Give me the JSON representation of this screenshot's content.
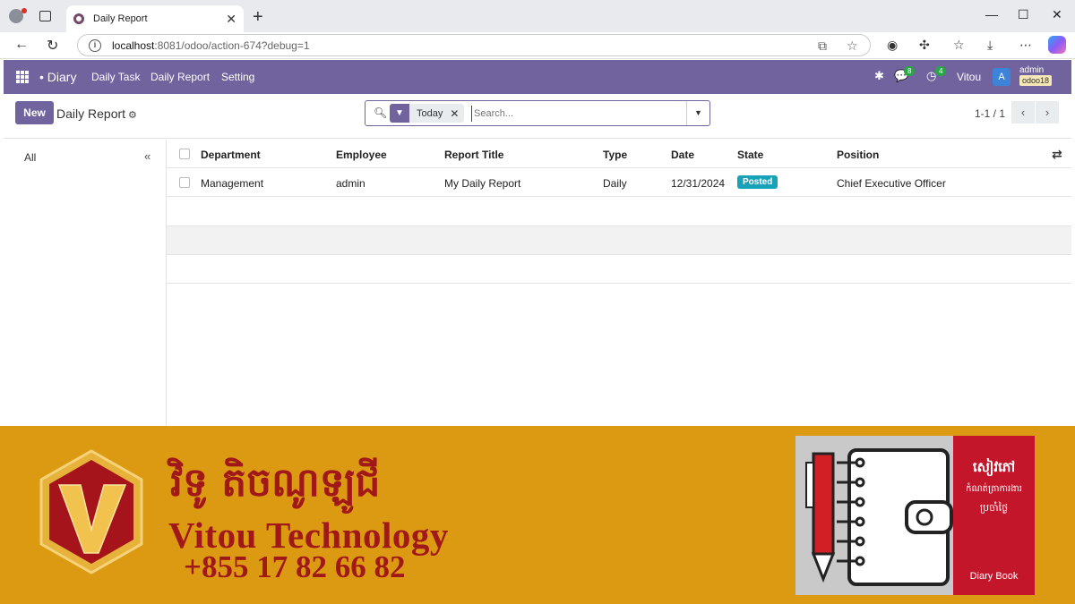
{
  "browser": {
    "tab_title": "Daily Report",
    "url_host": "localhost",
    "url_path": ":8081/odoo/action-674?debug=1"
  },
  "navbar": {
    "brand": "• Diary",
    "menu": [
      "Daily Task",
      "Daily Report",
      "Setting"
    ],
    "messages_count": "8",
    "activities_count": "4",
    "company_name": "Vitou",
    "avatar_letter": "A",
    "user_name": "admin",
    "db_name": "odoo18"
  },
  "control_panel": {
    "new_label": "New",
    "breadcrumb": "Daily Report",
    "facet_label": "Today",
    "search_placeholder": "Search...",
    "pager": "1-1 / 1"
  },
  "side_panel": {
    "all_label": "All",
    "collapse_symbol": "«"
  },
  "list": {
    "columns": [
      "Department",
      "Employee",
      "Report Title",
      "Type",
      "Date",
      "State",
      "Position"
    ],
    "rows": [
      {
        "department": "Management",
        "employee": "admin",
        "report_title": "My Daily Report",
        "type": "Daily",
        "date": "12/31/2024",
        "state": "Posted",
        "position": "Chief Executive Officer"
      }
    ]
  },
  "banner": {
    "khmer_title": "វិទូ តិចណូឡូជី",
    "company": "Vitou Technology",
    "phone": "+855 17 82 66 82",
    "book_khmer_1": "សៀវភៅ",
    "book_khmer_2": "កំណត់ត្រាការងារ",
    "book_khmer_3": "ប្រចាំថ្ងៃ",
    "book_english": "Diary Book",
    "colors": {
      "banner_bg": "#dc9a12",
      "text_red": "#a01818",
      "book_red": "#c3162b"
    }
  },
  "colors": {
    "odoo_primary": "#71639e",
    "posted_badge": "#17a2b8"
  }
}
